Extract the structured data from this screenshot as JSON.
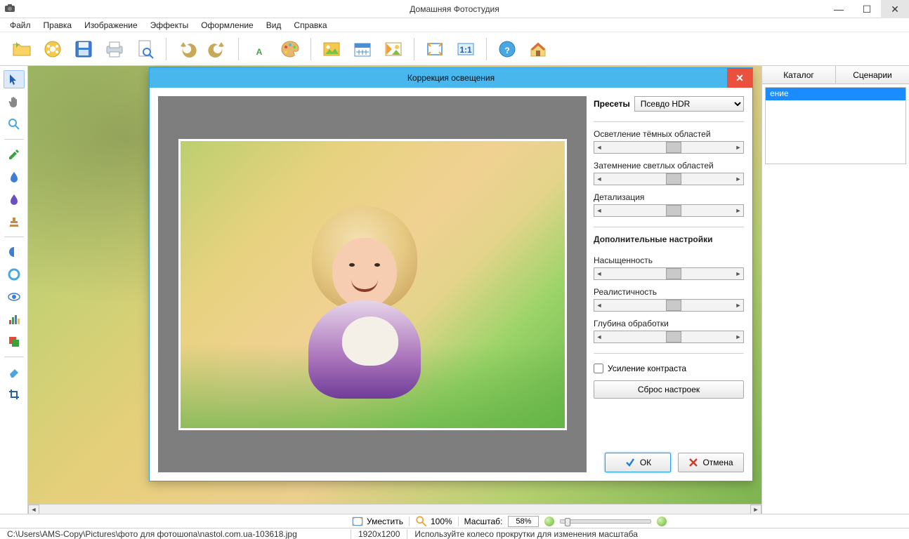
{
  "app": {
    "title": "Домашняя Фотостудия"
  },
  "menu": [
    "Файл",
    "Правка",
    "Изображение",
    "Эффекты",
    "Оформление",
    "Вид",
    "Справка"
  ],
  "toolbar": [
    {
      "name": "open",
      "icon": "folder"
    },
    {
      "name": "effects-wheel",
      "icon": "wheel"
    },
    {
      "name": "save",
      "icon": "save"
    },
    {
      "name": "print",
      "icon": "print"
    },
    {
      "name": "preview",
      "icon": "zoom-doc"
    },
    {
      "sep": true
    },
    {
      "name": "undo",
      "icon": "undo"
    },
    {
      "name": "redo",
      "icon": "redo"
    },
    {
      "sep": true
    },
    {
      "name": "text",
      "icon": "text"
    },
    {
      "name": "palette",
      "icon": "palette"
    },
    {
      "sep": true
    },
    {
      "name": "image",
      "icon": "image"
    },
    {
      "name": "calendar",
      "icon": "calendar"
    },
    {
      "name": "template",
      "icon": "template"
    },
    {
      "sep": true
    },
    {
      "name": "fit",
      "icon": "fit"
    },
    {
      "name": "100",
      "icon": "oneone"
    },
    {
      "sep": true
    },
    {
      "name": "help",
      "icon": "help"
    },
    {
      "name": "home",
      "icon": "home"
    }
  ],
  "right_panel": {
    "tabs": [
      "Каталог",
      "Сценарии"
    ],
    "list": [
      {
        "label": "ение",
        "sel": true
      }
    ]
  },
  "dialog": {
    "title": "Коррекция освещения",
    "presets_label": "Пресеты",
    "preset_value": "Псевдо HDR",
    "sliders": [
      {
        "label": "Осветление тёмных областей",
        "pos": 48
      },
      {
        "label": "Затемнение светлых областей",
        "pos": 48
      },
      {
        "label": "Детализация",
        "pos": 48
      }
    ],
    "advanced_heading": "Дополнительные настройки",
    "advanced": [
      {
        "label": "Насыщенность",
        "pos": 48
      },
      {
        "label": "Реалистичность",
        "pos": 48
      },
      {
        "label": "Глубина обработки",
        "pos": 48
      }
    ],
    "checkbox": "Усиление контраста",
    "reset": "Сброс настроек",
    "ok": "ОК",
    "cancel": "Отмена"
  },
  "zoom": {
    "fit": "Уместить",
    "hundred": "100%",
    "scale_label": "Масштаб:",
    "scale_value": "58%"
  },
  "status": {
    "path": "C:\\Users\\AMS-Copy\\Pictures\\фото для фотошопа\\nastol.com.ua-103618.jpg",
    "dims": "1920x1200",
    "hint": "Используйте колесо прокрутки для изменения масштаба"
  }
}
